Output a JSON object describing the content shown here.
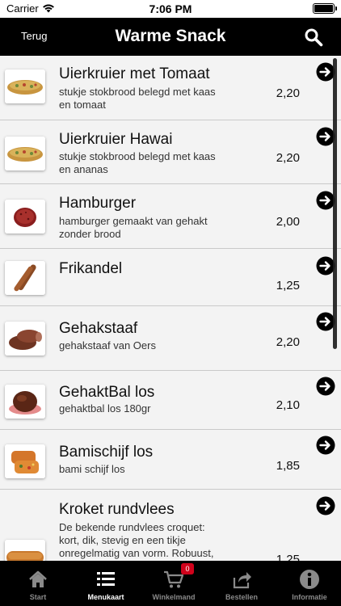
{
  "status_bar": {
    "carrier": "Carrier",
    "time": "7:06 PM"
  },
  "nav": {
    "back_label": "Terug",
    "title": "Warme Snack",
    "search_icon": "search-icon"
  },
  "items": [
    {
      "name": "Uierkruier met Tomaat",
      "desc": "stukje stokbrood belegd met kaas en tomaat",
      "price": "2,20",
      "thumb": "baguette"
    },
    {
      "name": "Uierkruier Hawai",
      "desc": "stukje stokbrood belegd met kaas en ananas",
      "price": "2,20",
      "thumb": "baguette"
    },
    {
      "name": "Hamburger",
      "desc": "hamburger gemaakt van gehakt zonder brood",
      "price": "2,00",
      "thumb": "patty"
    },
    {
      "name": "Frikandel",
      "desc": "",
      "price": "1,25",
      "thumb": "frikandel"
    },
    {
      "name": "Gehakstaaf",
      "desc": "gehakstaaf van Oers",
      "price": "2,20",
      "thumb": "meatstick"
    },
    {
      "name": "GehaktBal los",
      "desc": "gehaktbal los 180gr",
      "price": "2,10",
      "thumb": "meatball"
    },
    {
      "name": "Bamischijf los",
      "desc": "bami schijf los",
      "price": "1,85",
      "thumb": "bami"
    },
    {
      "name": "Kroket rundvlees",
      "desc": "De bekende rundvlees croquet: kort, dik, stevig en een tikje onregelmatig van vorm. Robuust, rijk gevuld en met een zachte",
      "price": "1,25",
      "thumb": "kroket"
    }
  ],
  "tabs": [
    {
      "label": "Start",
      "icon": "home-icon",
      "active": false
    },
    {
      "label": "Menukaart",
      "icon": "menu-list-icon",
      "active": true
    },
    {
      "label": "Winkelmand",
      "icon": "cart-icon",
      "active": false,
      "badge": "0"
    },
    {
      "label": "Bestellen",
      "icon": "share-icon",
      "active": false
    },
    {
      "label": "Informatie",
      "icon": "info-icon",
      "active": false
    }
  ],
  "colors": {
    "bar_background": "#000000",
    "list_background": "#f3f3f3",
    "tab_active": "#ffffff",
    "tab_inactive": "#8a8a8a",
    "badge": "#d0021b"
  }
}
